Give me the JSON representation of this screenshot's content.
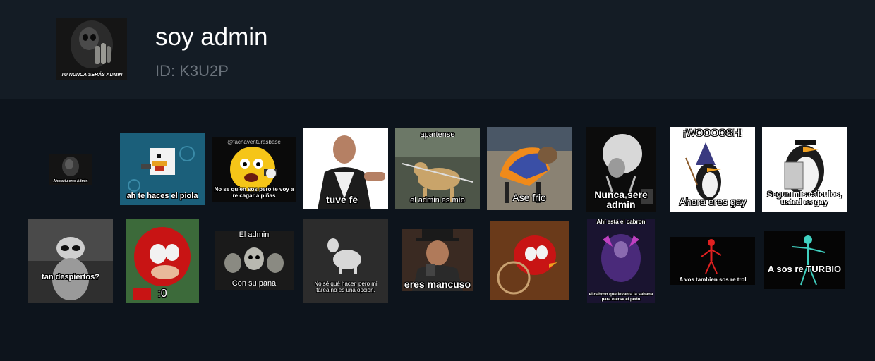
{
  "header": {
    "title": "soy admin",
    "id_label": "ID: K3U2P",
    "avatar_caption": "TU NUNCA SERÁS ADMIN"
  },
  "stickers": [
    {
      "name": "sticker-reaper-small",
      "caption": "Ahora tu eres Admin"
    },
    {
      "name": "sticker-minecraft-chicken",
      "caption": "ah te haces el piola"
    },
    {
      "name": "sticker-emoji-gun",
      "caption_top": "@fachaventurasbase",
      "caption": "No se quien sos pero te voy a re cagar a piñas"
    },
    {
      "name": "sticker-vin-diesel",
      "caption": "tuve fe"
    },
    {
      "name": "sticker-dog-sword",
      "caption_top": "apartense",
      "caption": "el admin es mío"
    },
    {
      "name": "sticker-dog-hoodie",
      "caption": "Ase frio"
    },
    {
      "name": "sticker-skeleton-moon",
      "caption": "Nunca sere admin"
    },
    {
      "name": "sticker-wizard-penguin",
      "caption_top": "¡WOOOOSH!",
      "caption": "Ahora eres gay"
    },
    {
      "name": "sticker-calculator-penguin",
      "caption": "Segun mis calculos, usted es gay"
    },
    {
      "name": "sticker-raccoon",
      "caption": "tan despiertos?"
    },
    {
      "name": "sticker-knuckles",
      "caption": ":0"
    },
    {
      "name": "sticker-skeleton-army",
      "caption_top": "El admin",
      "caption": "Con su pana"
    },
    {
      "name": "sticker-white-dog",
      "caption": "No sé qué hacer, pero mi tarea no es una opción."
    },
    {
      "name": "sticker-gunman",
      "caption": "eres mancuso"
    },
    {
      "name": "sticker-knuckles-wheelchair",
      "caption": ""
    },
    {
      "name": "sticker-demon",
      "caption_top": "Ahí está el cabron",
      "caption": "el cabron que levanta la sabana para olerse el pedo"
    },
    {
      "name": "sticker-red-skeleton",
      "caption": "A vos tambien sos re trol"
    },
    {
      "name": "sticker-cyan-skeleton",
      "caption": "A sos re TURBIO"
    }
  ],
  "colors": {
    "background": "#0d141c",
    "header": "#141c25",
    "id_text": "#6b737c"
  }
}
